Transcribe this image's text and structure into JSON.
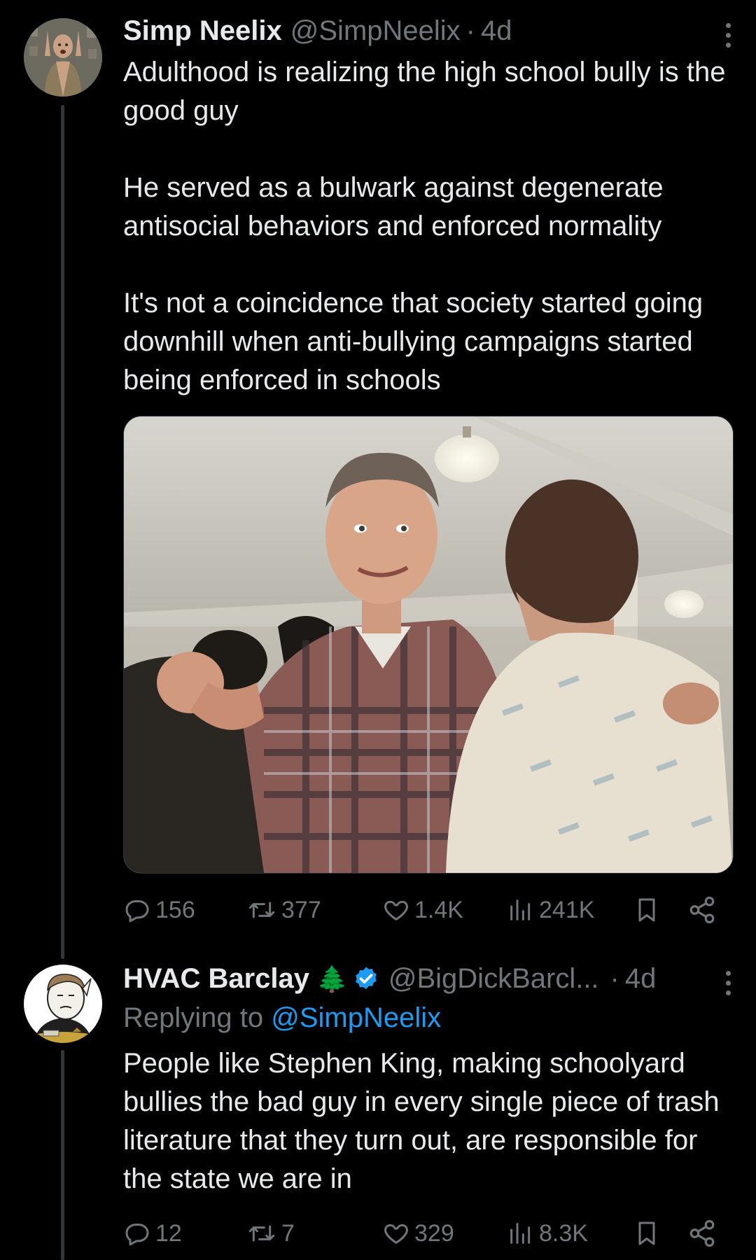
{
  "tweets": [
    {
      "author": {
        "name": "Simp Neelix",
        "handle": "@SimpNeelix",
        "avatar": "man-in-vest-avatar"
      },
      "separator": "·",
      "time": "4d",
      "paragraphs": [
        "Adulthood is realizing the high school bully is the good guy",
        "He served as a bulwark against degenerate antisocial behaviors and enforced normality",
        "It's not a coincidence that society started going downhill when anti-bullying campaigns started being enforced in schools"
      ],
      "stats": {
        "replies": "156",
        "retweets": "377",
        "likes": "1.4K",
        "views": "241K"
      }
    },
    {
      "author": {
        "name": "HVAC Barclay",
        "emoji": "🌲",
        "verified": true,
        "handle": "@BigDickBarcl...",
        "avatar": "starfleet-wojak-avatar"
      },
      "separator": "·",
      "time": "4d",
      "replying_to_label": "Replying to",
      "replying_to_handle": "@SimpNeelix",
      "paragraphs": [
        "People like Stephen King, making schoolyard bullies the bad guy in every single piece of trash literature that they turn out, are responsible for the state we are in"
      ],
      "stats": {
        "replies": "12",
        "retweets": "7",
        "likes": "329",
        "views": "8.3K"
      }
    }
  ],
  "icons": {
    "reply": "reply-bubble-icon",
    "retweet": "retweet-icon",
    "like": "heart-icon",
    "views": "views-bar-chart-icon",
    "bookmark": "bookmark-icon",
    "share": "share-icon",
    "more": "more-vertical-icon",
    "verified": "verified-badge-icon"
  },
  "colors": {
    "background": "#000000",
    "text": "#e7e9ea",
    "muted": "#71767b",
    "link": "#1d9bf0",
    "verified": "#1d9bf0"
  }
}
